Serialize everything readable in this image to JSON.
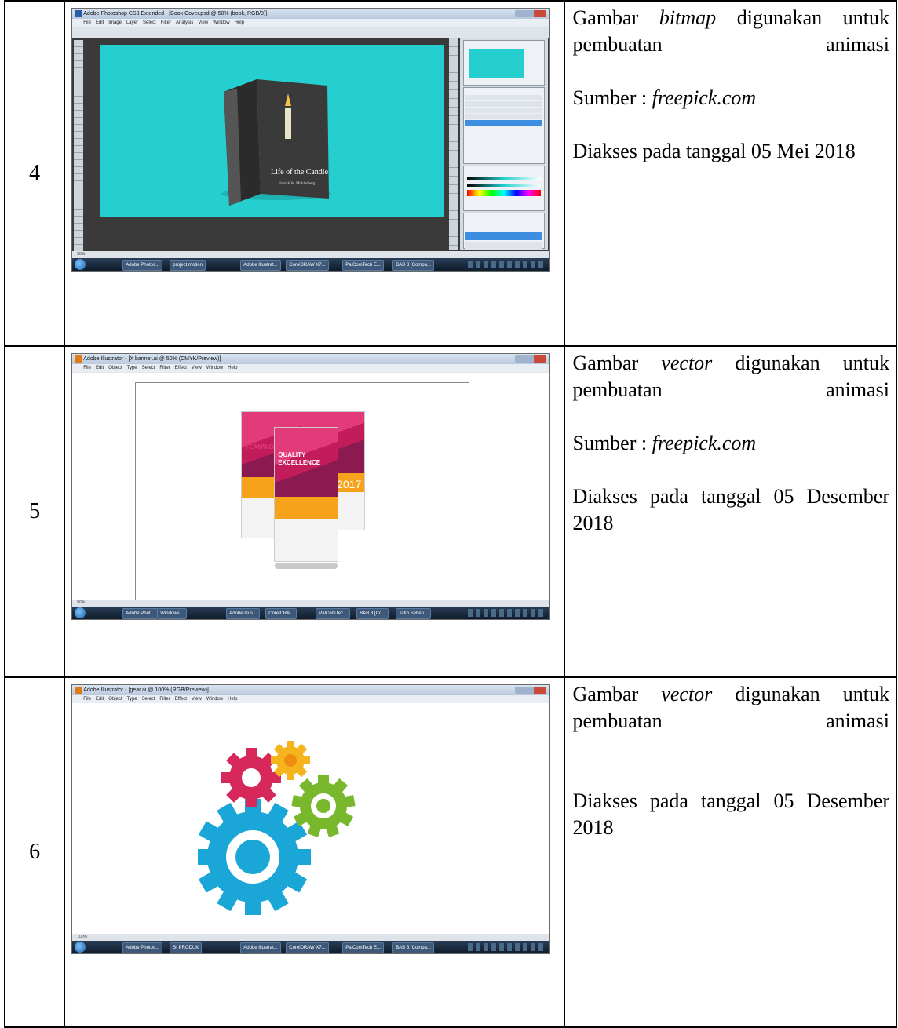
{
  "rows": [
    {
      "number": "4",
      "desc1_pre": "Gambar ",
      "desc1_em": "bitmap",
      "desc1_post": " digunakan untuk pembuatan animasi",
      "source_label": "Sumber : ",
      "source_site": "freepick.com",
      "accessed": "Diakses pada tanggal 05 Mei 2018",
      "screenshot": {
        "title": "Adobe Photoshop CS3 Extended - [Book Cover.psd @ 50% (book, RGB/8)]",
        "menu": [
          "File",
          "Edit",
          "Image",
          "Layer",
          "Select",
          "Filter",
          "Analysis",
          "View",
          "Window",
          "Help"
        ],
        "book_title": "Life of the Candle",
        "book_author": "Patrick W. Mohlenberg",
        "zoom": "50%",
        "canvas_color": "#25cfd0",
        "taskbar": [
          "Adobe Photos...",
          "project motion",
          "Adobe Illustrat...",
          "CorelDRAW X7...",
          "PalComTech E...",
          "BAB 3 [Compa..."
        ]
      }
    },
    {
      "number": "5",
      "desc1_pre": "Gambar ",
      "desc1_em": "vector",
      "desc1_post": " digunakan untuk pembuatan animasi",
      "source_label": "Sumber : ",
      "source_site": "freepick.com",
      "accessed": "Diakses pada tanggal 05 Desember 2018",
      "screenshot": {
        "title": "Adobe Illustrator - [X banner.ai @ 50% (CMYK/Preview)]",
        "menu": [
          "File",
          "Edit",
          "Object",
          "Type",
          "Select",
          "Filter",
          "Effect",
          "View",
          "Window",
          "Help"
        ],
        "banner_text_1": "TEAMWORK",
        "banner_text_2": "QUALITY",
        "banner_text_3": "EXCELLENCE",
        "banner_year": "2017",
        "zoom": "50%",
        "taskbar": [
          "Adobe Phot...",
          "Windows...",
          "Adobe Illus...",
          "CorelDRA...",
          "PalComTec...",
          "BAB 3 [Co...",
          "Tatih Sehen..."
        ]
      }
    },
    {
      "number": "6",
      "desc1_pre": "Gambar ",
      "desc1_em": "vector",
      "desc1_post": " digunakan untuk pembuatan animasi",
      "accessed": "Diakses pada tanggal 05 Desember 2018",
      "screenshot": {
        "title": "Adobe Illustrator - [gear.ai @ 100% (RGB/Preview)]",
        "menu": [
          "File",
          "Edit",
          "Object",
          "Type",
          "Select",
          "Filter",
          "Effect",
          "View",
          "Window",
          "Help"
        ],
        "zoom": "100%",
        "gear_colors": [
          "#1aa6d6",
          "#d6285a",
          "#f5b31c",
          "#79b72c"
        ],
        "taskbar": [
          "Adobe Photos...",
          "SI PRODUK",
          "Adobe Illustrat...",
          "CorelDRAW X7...",
          "PalComTech E...",
          "BAB 3 [Compa..."
        ]
      }
    }
  ]
}
